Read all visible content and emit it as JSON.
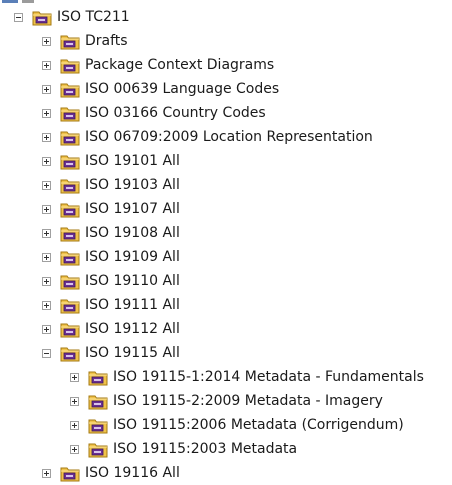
{
  "tree": {
    "root": {
      "label": "ISO TC211",
      "expanded": true,
      "icon": "package-icon"
    },
    "children": [
      {
        "label": "Drafts",
        "expanded": false
      },
      {
        "label": "Package Context Diagrams",
        "expanded": false
      },
      {
        "label": "ISO 00639 Language Codes",
        "expanded": false
      },
      {
        "label": "ISO 03166 Country Codes",
        "expanded": false
      },
      {
        "label": "ISO 06709:2009 Location Representation",
        "expanded": false
      },
      {
        "label": "ISO 19101 All",
        "expanded": false
      },
      {
        "label": "ISO 19103 All",
        "expanded": false
      },
      {
        "label": "ISO 19107 All",
        "expanded": false
      },
      {
        "label": "ISO 19108 All",
        "expanded": false
      },
      {
        "label": "ISO 19109 All",
        "expanded": false
      },
      {
        "label": "ISO 19110 All",
        "expanded": false
      },
      {
        "label": "ISO 19111 All",
        "expanded": false
      },
      {
        "label": "ISO 19112 All",
        "expanded": false
      },
      {
        "label": "ISO 19115 All",
        "expanded": true,
        "children": [
          {
            "label": "ISO 19115-1:2014 Metadata - Fundamentals",
            "expanded": false
          },
          {
            "label": "ISO 19115-2:2009 Metadata - Imagery",
            "expanded": false
          },
          {
            "label": "ISO 19115:2006 Metadata (Corrigendum)",
            "expanded": false
          },
          {
            "label": "ISO 19115:2003 Metadata",
            "expanded": false
          }
        ]
      },
      {
        "label": "ISO 19116 All",
        "expanded": false
      }
    ]
  },
  "colors": {
    "folder_body": "#f0c24a",
    "folder_edge": "#a57a12",
    "badge_fill": "#6a2f92",
    "badge_edge": "#3f1a5a",
    "toggle_border": "#a0a0a0",
    "text": "#1a1a1a"
  }
}
